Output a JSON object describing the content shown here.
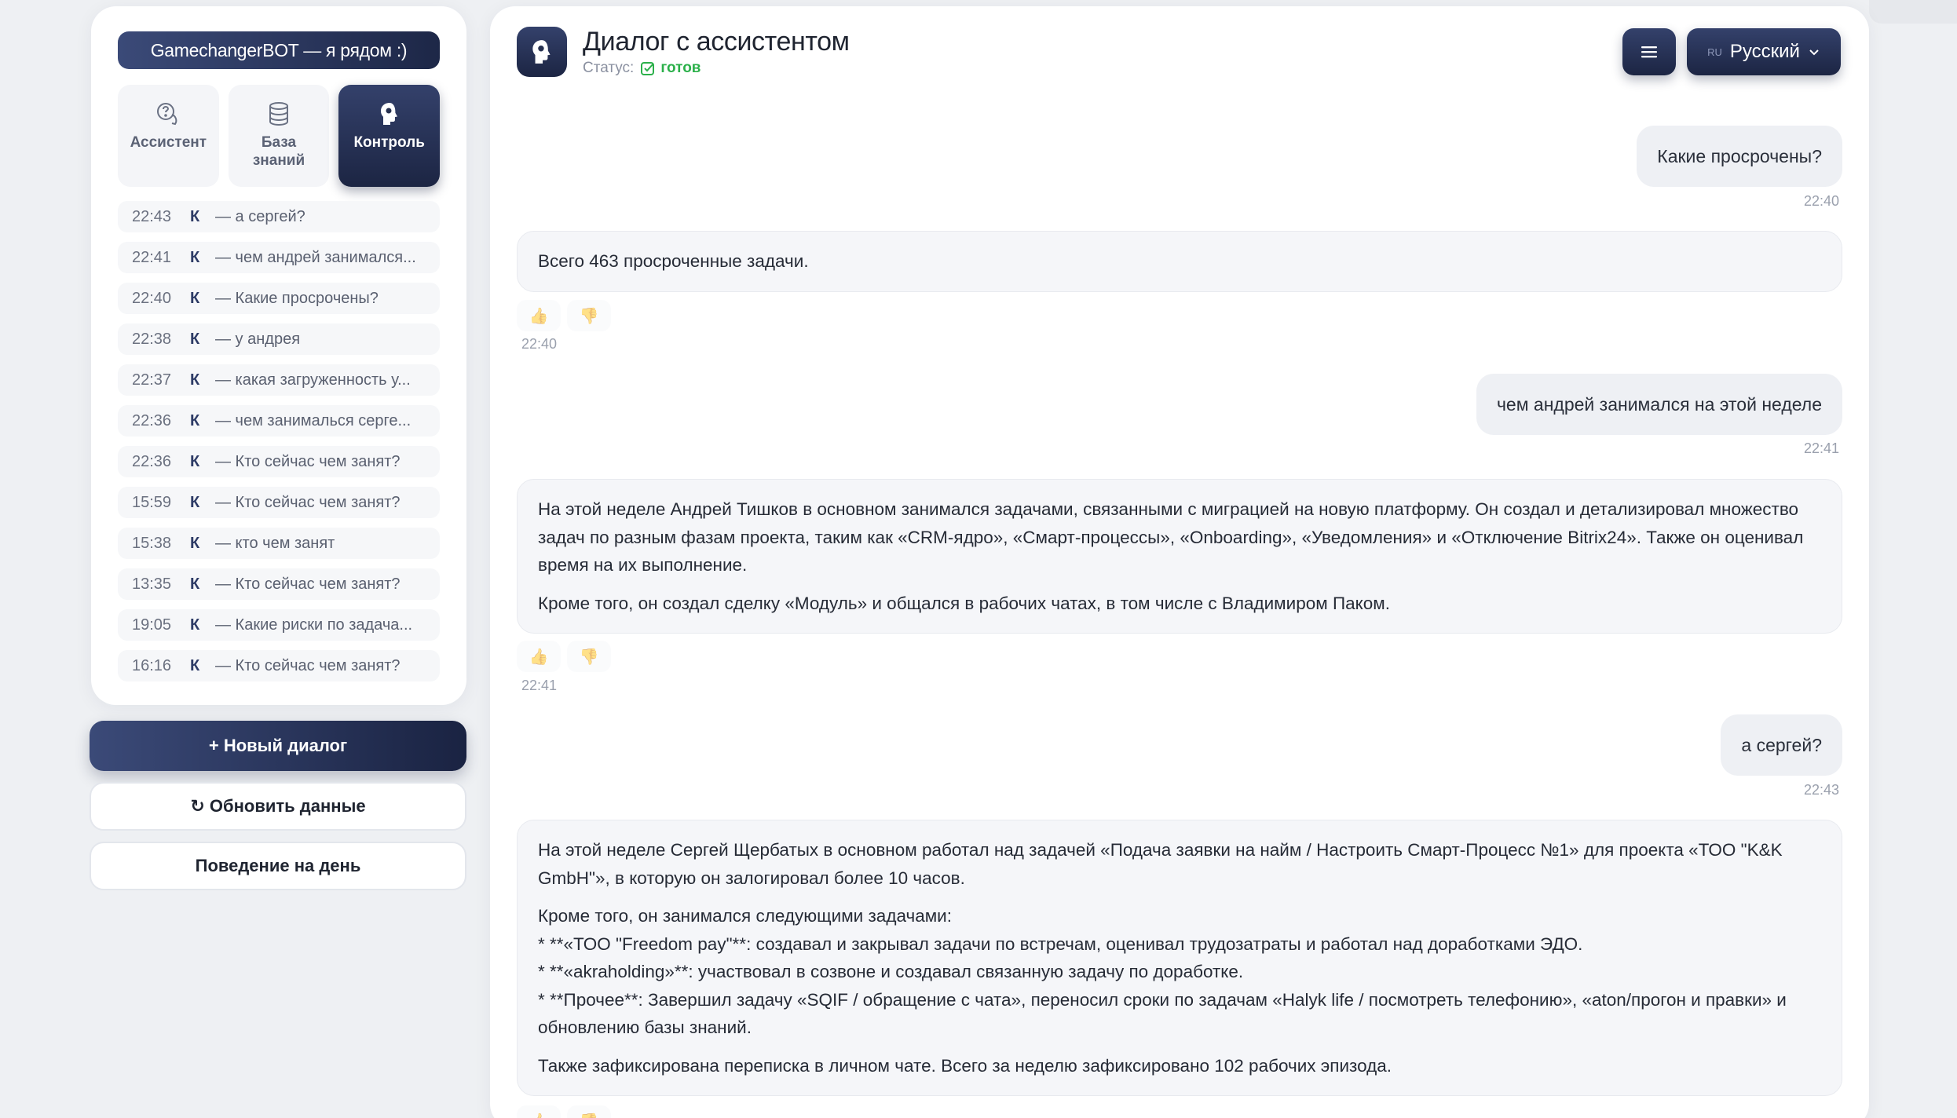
{
  "sidebar": {
    "brand": "GamechangerBOT — я рядом :)",
    "tabs": [
      {
        "label": "Ассистент",
        "icon": "chat-question-icon"
      },
      {
        "label": "База\nзнаний",
        "icon": "database-icon"
      },
      {
        "label": "Контроль",
        "icon": "brain-head-icon",
        "active": true
      }
    ],
    "history": [
      {
        "time": "22:43",
        "tag": "К",
        "text": "— а сергей?"
      },
      {
        "time": "22:41",
        "tag": "К",
        "text": "— чем андрей занимался..."
      },
      {
        "time": "22:40",
        "tag": "К",
        "text": "— Какие просрочены?"
      },
      {
        "time": "22:38",
        "tag": "К",
        "text": "— у андрея"
      },
      {
        "time": "22:37",
        "tag": "К",
        "text": "— какая загруженность у..."
      },
      {
        "time": "22:36",
        "tag": "К",
        "text": "— чем занималься серге..."
      },
      {
        "time": "22:36",
        "tag": "К",
        "text": "— Кто сейчас чем занят?"
      },
      {
        "time": "15:59",
        "tag": "К",
        "text": "— Кто сейчас чем занят?"
      },
      {
        "time": "15:38",
        "tag": "К",
        "text": "— кто чем занят"
      },
      {
        "time": "13:35",
        "tag": "К",
        "text": "— Кто сейчас чем занят?"
      },
      {
        "time": "19:05",
        "tag": "К",
        "text": "— Какие риски по задача..."
      },
      {
        "time": "16:16",
        "tag": "К",
        "text": "— Кто сейчас чем занят?"
      }
    ],
    "new_dialog": "+ Новый диалог",
    "refresh": "↻ Обновить данные",
    "day_behavior": "Поведение на день"
  },
  "header": {
    "title": "Диалог с ассистентом",
    "status_label": "Статус:",
    "status_value": "готов",
    "lang_code": "RU",
    "lang_label": "Русский"
  },
  "messages": {
    "m1": {
      "text": "Какие просрочены?",
      "time": "22:40"
    },
    "m2": {
      "p1": "Всего 463 просроченные задачи.",
      "time": "22:40"
    },
    "m3": {
      "text": "чем андрей занимался на этой неделе",
      "time": "22:41"
    },
    "m4": {
      "p1": "На этой неделе Андрей Тишков в основном занимался задачами, связанными с миграцией на новую платформу. Он создал и детализировал множество задач по разным фазам проекта, таким как «CRM-ядро», «Смарт-процессы», «Onboarding», «Уведомления» и «Отключение Bitrix24». Также он оценивал время на их выполнение.",
      "p2": "Кроме того, он создал сделку «Модуль» и общался в рабочих чатах, в том числе с Владимиром Паком.",
      "time": "22:41"
    },
    "m5": {
      "text": "а сергей?",
      "time": "22:43"
    },
    "m6": {
      "p1": "На этой неделе Сергей Щербатых в основном работал над задачей «Подача заявки на найм / Настроить Смарт-Процесс №1» для проекта «ТОО \"K&K GmbH\"», в которую он залогировал более 10 часов.",
      "p2": "Кроме того, он занимался следующими задачами:",
      "l1": "* **«ТОО \"Freedom pay\"**: создавал и закрывал задачи по встречам, оценивал трудозатраты и работал над доработками ЭДО.",
      "l2": "* **«akraholding»**: участвовал в созвоне и создавал связанную задачу по доработке.",
      "l3": "* **Прочее**: Завершил задачу «SQIF / обращение с чата», переносил сроки по задачам «Halyk life / посмотреть телефонию», «aton/прогон и правки» и обновлению базы знаний.",
      "p3": "Также зафиксирована переписка в личном чате. Всего за неделю зафиксировано 102 рабочих эпизода."
    }
  }
}
